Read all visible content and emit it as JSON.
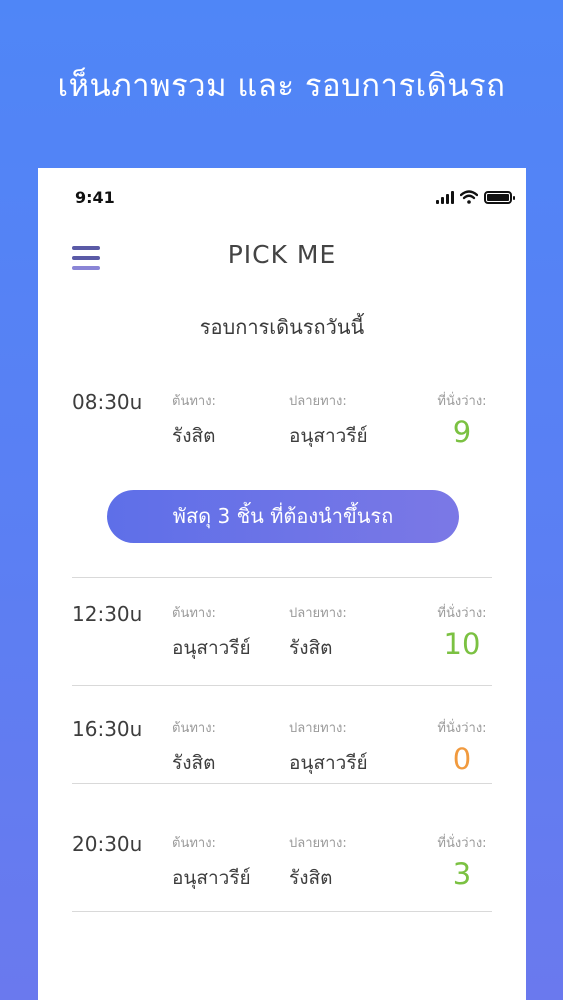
{
  "headline": "เห็นภาพรวม และ รอบการเดินรถ",
  "status_bar": {
    "time": "9:41",
    "icons": [
      "signal-icon",
      "wifi-icon",
      "battery-icon"
    ]
  },
  "app": {
    "title": "PICK ME",
    "menu_icon": "hamburger-menu-icon"
  },
  "section_title": "รอบการเดินรถวันนี้",
  "labels": {
    "origin": "ต้นทาง:",
    "destination": "ปลายทาง:",
    "seats": "ที่นั่งว่าง:"
  },
  "trips": [
    {
      "time": "08:30u",
      "origin": "รังสิต",
      "destination": "อนุสาวรีย์",
      "seats": "9",
      "seat_color": "#7bc142"
    },
    {
      "time": "12:30u",
      "origin": "อนุสาวรีย์",
      "destination": "รังสิต",
      "seats": "10",
      "seat_color": "#7bc142"
    },
    {
      "time": "16:30u",
      "origin": "รังสิต",
      "destination": "อนุสาวรีย์",
      "seats": "0",
      "seat_color": "#f19a3e"
    },
    {
      "time": "20:30u",
      "origin": "อนุสาวรีย์",
      "destination": "รังสิต",
      "seats": "3",
      "seat_color": "#7bc142"
    }
  ],
  "parcel_button": {
    "label": "พัสดุ 3 ชิ้น ที่ต้องนำขึ้นรถ"
  },
  "colors": {
    "accent_gradient_start": "#4f86f7",
    "accent_gradient_end": "#6a79ee",
    "seat_available": "#7bc142",
    "seat_full": "#f19a3e"
  }
}
